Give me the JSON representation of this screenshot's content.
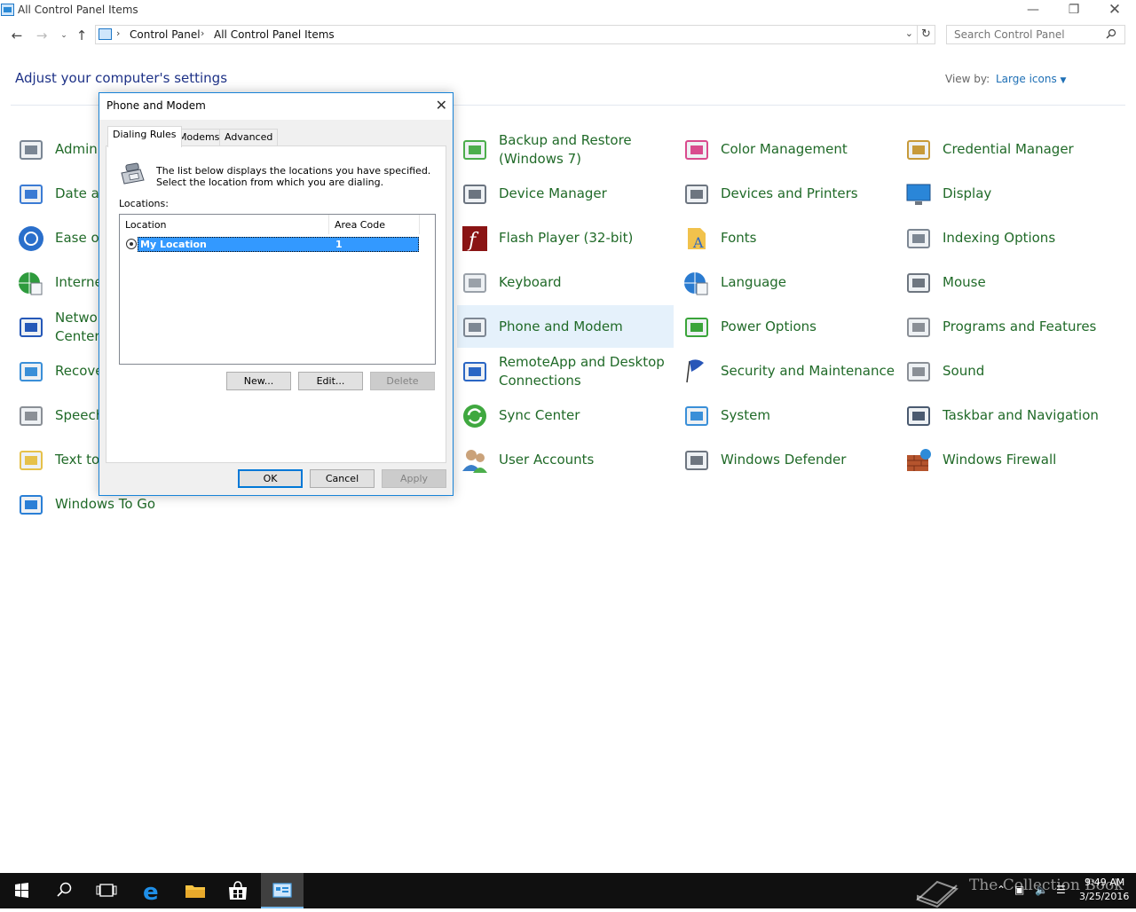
{
  "window": {
    "title": "All Control Panel Items"
  },
  "address": {
    "crumbs": [
      "Control Panel",
      "All Control Panel Items"
    ],
    "search_placeholder": "Search Control Panel"
  },
  "header": {
    "title": "Adjust your computer's settings",
    "view_by_label": "View by:",
    "view_by_value": "Large icons"
  },
  "items": [
    {
      "name": "Admini",
      "icon": "admin-tools-icon",
      "two": false
    },
    {
      "name": "Date ar",
      "icon": "date-time-icon",
      "two": false
    },
    {
      "name": "Ease of",
      "icon": "ease-of-access-icon",
      "two": false
    },
    {
      "name": "Interne",
      "icon": "internet-options-icon",
      "two": false
    },
    {
      "name": "Networ\nCenter",
      "icon": "network-center-icon",
      "two": true
    },
    {
      "name": "Recove",
      "icon": "recovery-icon",
      "two": false
    },
    {
      "name": "Speech",
      "icon": "speech-icon",
      "two": false
    },
    {
      "name": "Text to",
      "icon": "text-to-speech-icon",
      "two": false
    },
    {
      "name": "Windows To Go",
      "icon": "windows-to-go-icon",
      "two": false
    },
    {
      "name": "Backup and Restore (Windows 7)",
      "icon": "backup-restore-icon",
      "two": true
    },
    {
      "name": "Device Manager",
      "icon": "device-manager-icon",
      "two": false
    },
    {
      "name": "Flash Player (32-bit)",
      "icon": "flash-player-icon",
      "two": false
    },
    {
      "name": "Keyboard",
      "icon": "keyboard-icon",
      "two": false
    },
    {
      "name": "Phone and Modem",
      "icon": "phone-modem-icon",
      "two": false
    },
    {
      "name": "RemoteApp and Desktop Connections",
      "icon": "remoteapp-icon",
      "two": true
    },
    {
      "name": "Sync Center",
      "icon": "sync-center-icon",
      "two": false
    },
    {
      "name": "User Accounts",
      "icon": "user-accounts-icon",
      "two": false
    },
    {
      "name": "Color Management",
      "icon": "color-management-icon",
      "two": false
    },
    {
      "name": "Devices and Printers",
      "icon": "devices-printers-icon",
      "two": false
    },
    {
      "name": "Fonts",
      "icon": "fonts-icon",
      "two": false
    },
    {
      "name": "Language",
      "icon": "language-icon",
      "two": false
    },
    {
      "name": "Power Options",
      "icon": "power-options-icon",
      "two": false
    },
    {
      "name": "Security and Maintenance",
      "icon": "security-flag-icon",
      "two": false
    },
    {
      "name": "System",
      "icon": "system-icon",
      "two": false
    },
    {
      "name": "Windows Defender",
      "icon": "windows-defender-icon",
      "two": false
    },
    {
      "name": "Credential Manager",
      "icon": "credential-manager-icon",
      "two": false
    },
    {
      "name": "Display",
      "icon": "display-icon",
      "two": false
    },
    {
      "name": "Indexing Options",
      "icon": "indexing-options-icon",
      "two": false
    },
    {
      "name": "Mouse",
      "icon": "mouse-icon",
      "two": false
    },
    {
      "name": "Programs and Features",
      "icon": "programs-features-icon",
      "two": false
    },
    {
      "name": "Sound",
      "icon": "sound-icon",
      "two": false
    },
    {
      "name": "Taskbar and Navigation",
      "icon": "taskbar-navigation-icon",
      "two": false
    },
    {
      "name": "Windows Firewall",
      "icon": "windows-firewall-icon",
      "two": false
    }
  ],
  "dialog": {
    "title": "Phone and Modem",
    "tabs": [
      "Dialing Rules",
      "Modems",
      "Advanced"
    ],
    "description": "The list below displays the locations you have specified. Select the location from which you are dialing.",
    "locations_label": "Locations:",
    "columns": [
      "Location",
      "Area Code"
    ],
    "rows": [
      {
        "location": "My Location",
        "area_code": "1"
      }
    ],
    "buttons": {
      "new": "New...",
      "edit": "Edit...",
      "delete": "Delete",
      "ok": "OK",
      "cancel": "Cancel",
      "apply": "Apply"
    }
  },
  "taskbar": {
    "time": "9:49 AM",
    "date": "3/25/2016",
    "watermark": "The Collection Book"
  }
}
